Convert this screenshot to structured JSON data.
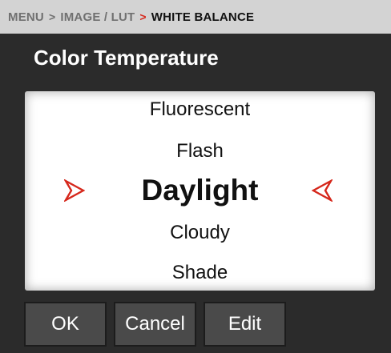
{
  "breadcrumb": {
    "items": [
      "MENU",
      "IMAGE / LUT",
      "WHITE BALANCE"
    ],
    "separator_1": ">",
    "separator_2": ">"
  },
  "title": "Color Temperature",
  "picker": {
    "options": [
      "Fluorescent",
      "Flash",
      "Daylight",
      "Cloudy",
      "Shade"
    ],
    "selected": "Daylight"
  },
  "buttons": {
    "ok": "OK",
    "cancel": "Cancel",
    "edit": "Edit"
  },
  "icons": {
    "left_arrow": "chevron-right-icon",
    "right_arrow": "chevron-left-icon"
  },
  "colors": {
    "accent": "#d6281c",
    "background": "#2b2b2b",
    "breadcrumb_bar": "#d3d3d3",
    "button": "#4a4a4a"
  }
}
